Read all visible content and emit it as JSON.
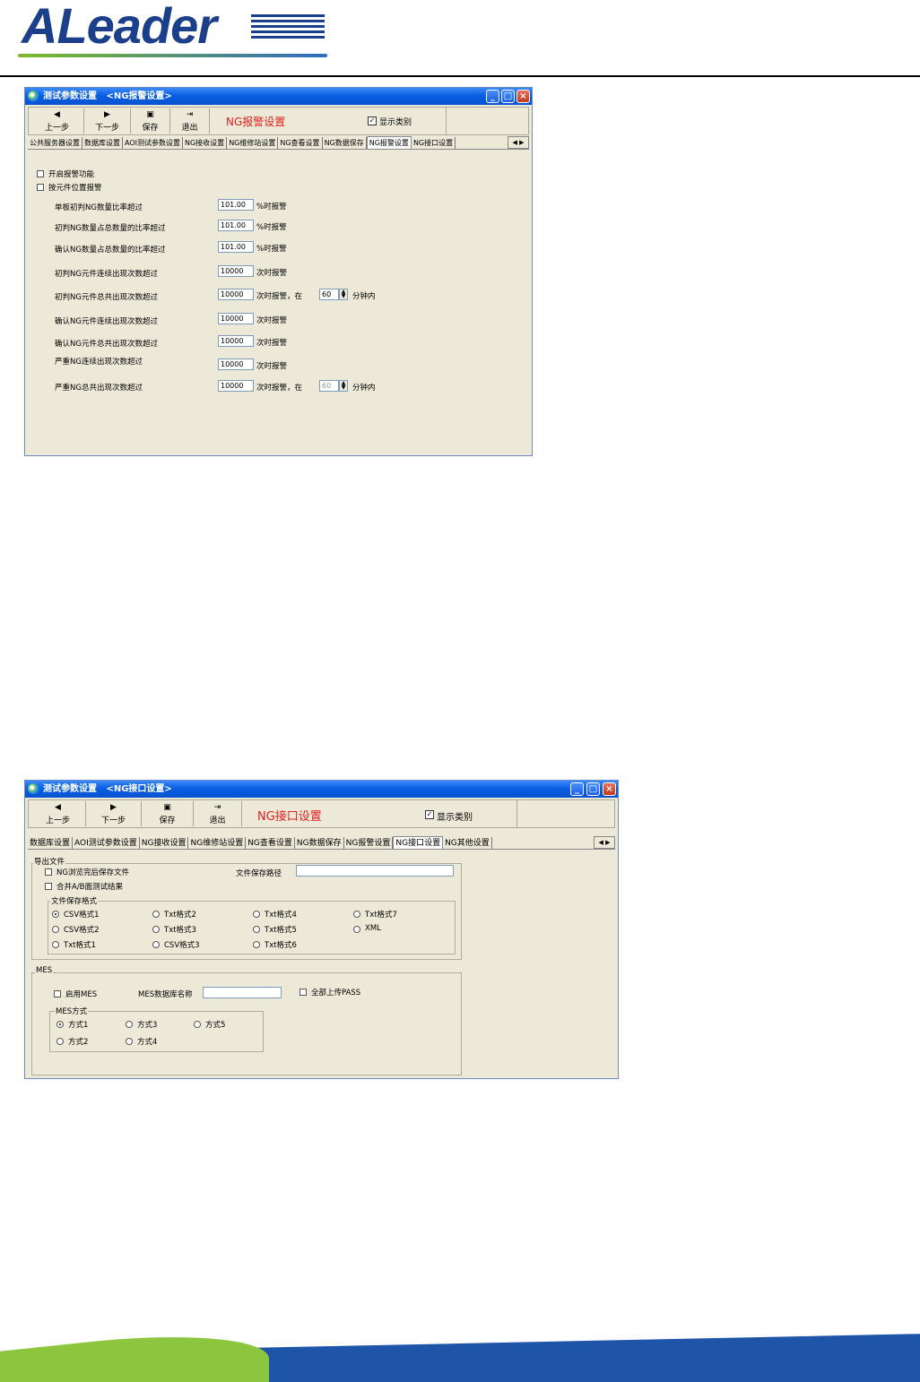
{
  "logo": {
    "text": "ALeader"
  },
  "window1": {
    "title": "测试参数设置   <NG报警设置>",
    "toolbar": {
      "prev": "上一步",
      "next": "下一步",
      "save": "保存",
      "exit": "退出"
    },
    "heading": "NG报警设置",
    "show_category": {
      "label": "显示类别",
      "checked": true
    },
    "tabs": [
      "公共服务器设置",
      "数据库设置",
      "AOI测试参数设置",
      "NG接收设置",
      "NG维修站设置",
      "NG查看设置",
      "NG数据保存",
      "NG报警设置",
      "NG接口设置"
    ],
    "active_tab": "NG报警设置",
    "checkbox_alarm": "开启报警功能",
    "checkbox_position": "按元件位置报警",
    "rows": [
      {
        "label": "单板初判NG数量比率超过",
        "value": "101.00",
        "suffix": "%时报警"
      },
      {
        "label": "初判NG数量占总数量的比率超过",
        "value": "101.00",
        "suffix": "%时报警"
      },
      {
        "label": "确认NG数量占总数量的比率超过",
        "value": "101.00",
        "suffix": "%时报警"
      },
      {
        "label": "初判NG元件连续出现次数超过",
        "value": "10000",
        "suffix": "次时报警"
      },
      {
        "label": "初判NG元件总共出现次数超过",
        "value": "10000",
        "suffix": "次时报警，在",
        "minutes": "60",
        "minutes_suffix": "分钟内"
      },
      {
        "label": "确认NG元件连续出现次数超过",
        "value": "10000",
        "suffix": "次时报警"
      },
      {
        "label": "确认NG元件总共出现次数超过",
        "value": "10000",
        "suffix": "次时报警"
      },
      {
        "label": "严重NG连续出现次数超过",
        "value": "10000",
        "suffix": "次时报警"
      },
      {
        "label": "严重NG总共出现次数超过",
        "value": "10000",
        "suffix": "次时报警，在",
        "minutes": "60",
        "minutes_suffix": "分钟内"
      }
    ]
  },
  "window2": {
    "title": "测试参数设置   <NG接口设置>",
    "toolbar": {
      "prev": "上一步",
      "next": "下一步",
      "save": "保存",
      "exit": "退出"
    },
    "heading": "NG接口设置",
    "show_category": {
      "label": "显示类别",
      "checked": true
    },
    "tabs": [
      "数据库设置",
      "AOI测试参数设置",
      "NG接收设置",
      "NG维修站设置",
      "NG查看设置",
      "NG数据保存",
      "NG报警设置",
      "NG接口设置",
      "NG其他设置"
    ],
    "active_tab": "NG接口设置",
    "export_group": "导出文件",
    "export_cb1": "NG浏览完后保存文件",
    "export_cb2": "合并A/B面测试结果",
    "path_label": "文件保存路径",
    "path_value": "",
    "format_group": "文件保存格式",
    "formats": [
      "CSV格式1",
      "Txt格式2",
      "Txt格式4",
      "Txt格式7",
      "CSV格式2",
      "Txt格式3",
      "Txt格式5",
      "XML",
      "Txt格式1",
      "CSV格式3",
      "Txt格式6"
    ],
    "format_selected": "CSV格式1",
    "mes_group": "MES",
    "mes_enable": "启用MES",
    "mes_db_label": "MES数据库名称",
    "mes_db_value": "",
    "mes_all_pass": "全部上传PASS",
    "mes_mode_group": "MES方式",
    "mes_modes": [
      "方式1",
      "方式3",
      "方式5",
      "方式2",
      "方式4"
    ],
    "mes_mode_selected": "方式1"
  }
}
